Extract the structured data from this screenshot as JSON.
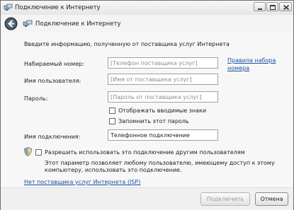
{
  "window": {
    "title": "Подключение к Интернету",
    "min_label": "_",
    "max_label": "□",
    "close_label": "X"
  },
  "nav": {
    "title": "Подключение к Интернету"
  },
  "form": {
    "intro": "Введите информацию, полученную от поставщика услуг Интернета",
    "phone_label": "Набираемый номер:",
    "phone_placeholder": "[Телефон поставщика услуг]",
    "phone_value": "",
    "dialing_rules_link_line1": "Правила набора",
    "dialing_rules_link_line2": "номера",
    "username_label": "Имя пользователя:",
    "username_placeholder": "[Имя от поставщика услуг]",
    "username_value": "",
    "password_label": "Пароль:",
    "password_placeholder": "[Пароль от поставщика услуг]",
    "password_value": "",
    "show_chars_label": "Отображать вводимые знаки",
    "show_chars_checked": false,
    "remember_password_label": "Запомнить этот пароль",
    "remember_password_checked": false,
    "connection_name_label": "Имя подключения:",
    "connection_name_value": "Телефонное подключение",
    "allow_others_label": "Разрешить использовать это подключение другим пользователям",
    "allow_others_checked": false,
    "allow_others_description_line1": "Этот параметр позволяет любому пользователю, имеющему доступ к этому",
    "allow_others_description_line2": "компьютеру, использовать это подключение.",
    "no_isp_link": "Нет поставщика услуг Интернета (ISP)"
  },
  "buttons": {
    "connect_label": "Подключить",
    "connect_enabled": false,
    "cancel_label": "Отмена"
  }
}
